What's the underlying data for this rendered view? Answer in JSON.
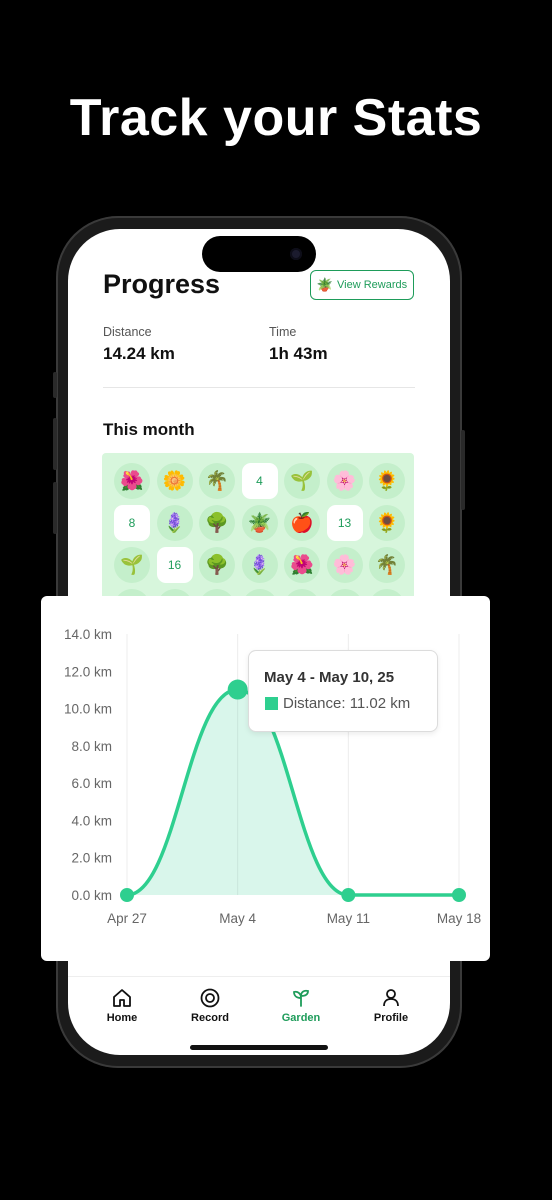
{
  "headline": "Track your Stats",
  "header": {
    "title": "Progress",
    "rewards_label": "View Rewards",
    "rewards_icon": "potted-plant-icon"
  },
  "stats": {
    "distance_label": "Distance",
    "distance_value": "14.24 km",
    "time_label": "Time",
    "time_value": "1h 43m"
  },
  "section_title": "This month",
  "garden": {
    "rows": [
      [
        "🌺",
        "🌼",
        "🌴",
        "4",
        "🌱",
        "🌸",
        "🌻"
      ],
      [
        "8",
        "🪻",
        "🌳",
        "🪴",
        "🍎",
        "13",
        "🌻"
      ],
      [
        "🌱",
        "16",
        "🌳",
        "🪻",
        "🌺",
        "🌸",
        "🌴"
      ]
    ]
  },
  "chart_data": {
    "type": "area",
    "x": [
      "Apr 27",
      "May 4",
      "May 11",
      "May 18"
    ],
    "series": [
      {
        "values": [
          0,
          11.02,
          0,
          0
        ]
      }
    ],
    "y_ticks": [
      "0.0 km",
      "2.0 km",
      "4.0 km",
      "6.0 km",
      "8.0 km",
      "10.0 km",
      "12.0 km",
      "14.0 km"
    ],
    "ylim": [
      0,
      14
    ],
    "grid": "vertical",
    "color": "#2ecf8f",
    "tooltip": {
      "title": "May 4 - May 10, 25",
      "label": "Distance: 11.02 km"
    }
  },
  "nav": {
    "items": [
      {
        "label": "Home",
        "icon": "home-icon"
      },
      {
        "label": "Record",
        "icon": "record-icon"
      },
      {
        "label": "Garden",
        "icon": "sprout-icon"
      },
      {
        "label": "Profile",
        "icon": "person-icon"
      }
    ],
    "active": "Garden",
    "active_color": "#1e9c5a"
  }
}
